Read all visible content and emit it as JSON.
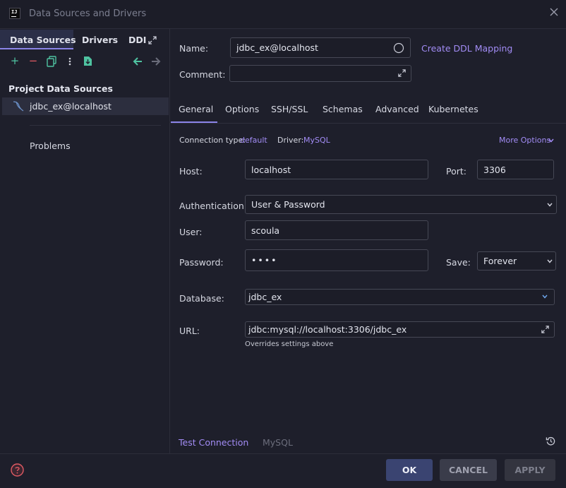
{
  "window": {
    "title": "Data Sources and Drivers",
    "app_icon": "intellij-icon"
  },
  "left": {
    "tabs": [
      {
        "label": "Data Sources",
        "active": true
      },
      {
        "label": "Drivers",
        "active": false
      },
      {
        "label": "DDI",
        "active": false
      }
    ],
    "toolbar": {
      "add": "+",
      "remove": "−",
      "copy_icon": "copy-icon",
      "more_icon": "more-vertical-icon",
      "import_icon": "import-icon",
      "back_icon": "arrow-left-icon",
      "forward_icon": "arrow-right-icon"
    },
    "section_title": "Project Data Sources",
    "data_sources": [
      {
        "label": "jdbc_ex@localhost",
        "icon": "mysql-dolphin-icon"
      }
    ],
    "problems_label": "Problems"
  },
  "form": {
    "name_label": "Name:",
    "name_value": "jdbc_ex@localhost",
    "create_ddl_link": "Create DDL Mapping",
    "comment_label": "Comment:",
    "comment_value": "",
    "tabs": [
      {
        "label": "General",
        "active": true
      },
      {
        "label": "Options",
        "active": false
      },
      {
        "label": "SSH/SSL",
        "active": false
      },
      {
        "label": "Schemas",
        "active": false
      },
      {
        "label": "Advanced",
        "active": false
      },
      {
        "label": "Kubernetes",
        "active": false
      }
    ],
    "connection_type_label": "Connection type:",
    "connection_type_value": "default",
    "driver_label": "Driver:",
    "driver_value": "MySQL",
    "more_options": "More Options",
    "host_label": "Host:",
    "host_value": "localhost",
    "port_label": "Port:",
    "port_value": "3306",
    "auth_label": "Authentication:",
    "auth_value": "User & Password",
    "user_label": "User:",
    "user_value": "scoula",
    "password_label": "Password:",
    "password_value": "••••",
    "save_label": "Save:",
    "save_value": "Forever",
    "database_label": "Database:",
    "database_value": "jdbc_ex",
    "url_label": "URL:",
    "url_value": "jdbc:mysql://localhost:3306/jdbc_ex",
    "url_hint": "Overrides settings above"
  },
  "footer": {
    "test_connection": "Test Connection",
    "driver_name": "MySQL",
    "ok": "OK",
    "cancel": "CANCEL",
    "apply": "APPLY"
  },
  "colors": {
    "accent": "#8b84e8",
    "link": "#a28cf5",
    "ok_button": "#3a4471",
    "help_icon": "#e05a63"
  }
}
